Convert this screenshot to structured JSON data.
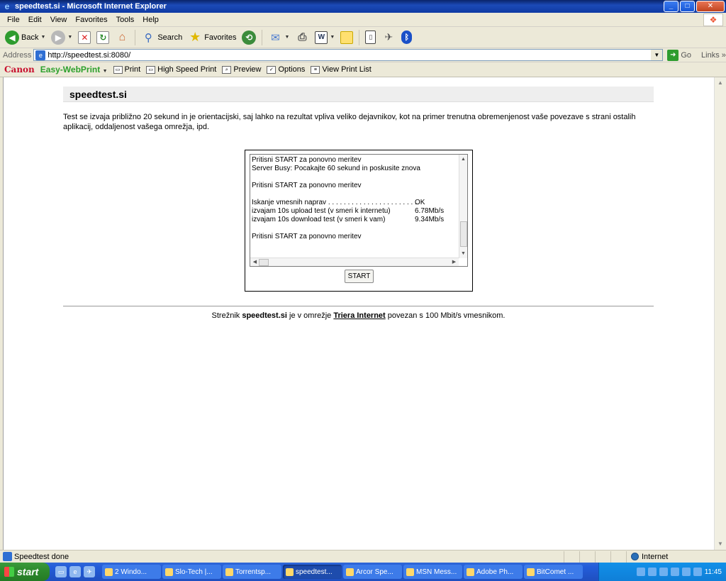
{
  "window": {
    "title": "speedtest.si - Microsoft Internet Explorer",
    "minimize": "_",
    "maximize": "□",
    "close": "✕"
  },
  "menu": [
    "File",
    "Edit",
    "View",
    "Favorites",
    "Tools",
    "Help"
  ],
  "toolbar": {
    "back": "Back",
    "search": "Search",
    "favorites": "Favorites"
  },
  "address": {
    "label": "Address",
    "url": "http://speedtest.si:8080/",
    "go": "Go",
    "links": "Links"
  },
  "canon": {
    "brand": "Canon",
    "product": "Easy-WebPrint",
    "print": "Print",
    "high_speed_print": "High Speed Print",
    "preview": "Preview",
    "options": "Options",
    "view_print_list": "View Print List"
  },
  "page": {
    "title": "speedtest.si",
    "intro": "Test se izvaja približno 20 sekund in je orientacijski, saj lahko na rezultat vpliva veliko dejavnikov, kot na primer trenutna obremenjenost vaše povezave s strani ostalih aplikacij, oddaljenost vašega omrežja, ipd.",
    "log": {
      "line1": "Pritisni START za ponovno meritev",
      "line2": "Server Busy: Pocakajte 60 sekund in poskusite znova",
      "line3": "Pritisni START za ponovno meritev",
      "line4_label": "Iskanje vmesnih naprav . . . . . . . . . . . . . . . . . . . . . . .",
      "line4_value": "OK",
      "line5_label": "izvajam 10s upload test (v smeri k internetu)",
      "line5_value": "6.78Mb/s",
      "line6_label": "izvajam 10s download test (v smeri k vam)",
      "line6_value": "9.34Mb/s",
      "line7": "Pritisni START za ponovno meritev"
    },
    "start_button": "START",
    "footer_prefix": "Strežnik",
    "footer_server": "speedtest.si",
    "footer_mid": "je v omrežje",
    "footer_network": "Triera Internet",
    "footer_suffix": "povezan s 100 Mbit/s vmesnikom."
  },
  "status": {
    "text": "Speedtest done",
    "zone": "Internet"
  },
  "taskbar": {
    "start": "start",
    "tasks": [
      "2 Windo...",
      "Slo-Tech |...",
      "Torrentsp...",
      "speedtest...",
      "Arcor Spe...",
      "MSN Mess...",
      "Adobe Ph...",
      "BitComet ..."
    ],
    "clock": "11:45"
  }
}
